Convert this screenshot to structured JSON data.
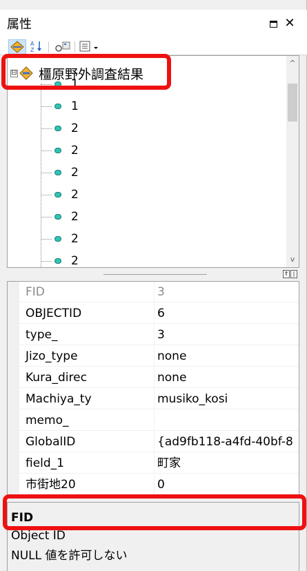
{
  "window": {
    "title": "属性",
    "close_glyph": "✕"
  },
  "toolbar": {
    "buttons": [
      {
        "icon": "attributes-layer-icon"
      },
      {
        "icon": "sort-alphabetical-icon"
      },
      {
        "icon": "editing-options-icon"
      },
      {
        "icon": "list-options-dropdown-icon"
      }
    ]
  },
  "tree": {
    "expander_glyph": "⊟",
    "root_label": "橿原野外調査結果",
    "items": [
      "1",
      "1",
      "2",
      "2",
      "2",
      "2",
      "2",
      "2",
      "2"
    ],
    "scroll_up": "^",
    "scroll_down": "v"
  },
  "grid": {
    "rows": [
      {
        "name": "FID",
        "value": "3",
        "readonly": true
      },
      {
        "name": "OBJECTID",
        "value": "6",
        "readonly": false
      },
      {
        "name": "type_",
        "value": "3",
        "readonly": false
      },
      {
        "name": "Jizo_type",
        "value": "none",
        "readonly": false
      },
      {
        "name": "Kura_direc",
        "value": "none",
        "readonly": false
      },
      {
        "name": "Machiya_ty",
        "value": "musiko_kosi",
        "readonly": false
      },
      {
        "name": "memo_",
        "value": "",
        "readonly": false
      },
      {
        "name": "GlobalID",
        "value": "{ad9fb118-a4fd-40bf-8",
        "readonly": false
      },
      {
        "name": "field_1",
        "value": "町家",
        "readonly": false
      },
      {
        "name": "市街地20",
        "value": "0",
        "readonly": false
      }
    ]
  },
  "description": {
    "title": "FID",
    "line1": "Object ID",
    "line2": "NULL 値を許可しない"
  },
  "colors": {
    "highlight": "#ee1111",
    "feature_icon": "#2ec4b6",
    "readonly_text": "#8a8a8a"
  }
}
